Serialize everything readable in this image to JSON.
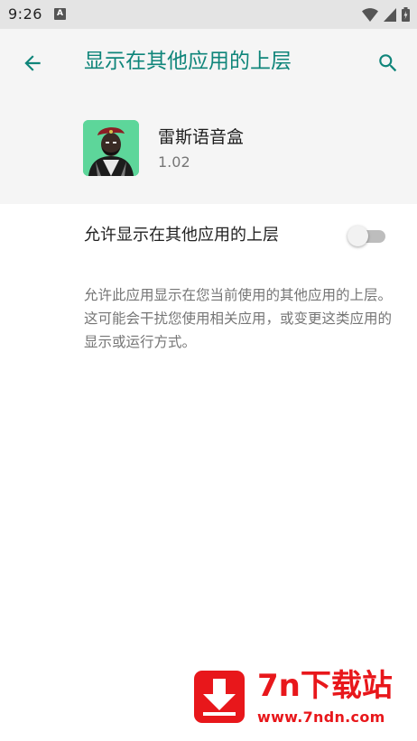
{
  "status_bar": {
    "time": "9:26",
    "notification_icon": "A"
  },
  "header": {
    "back_icon": "arrow-left-icon",
    "title": "显示在其他应用的上层",
    "search_icon": "search-icon",
    "accent_color": "#0f857a"
  },
  "app": {
    "name": "雷斯语音盒",
    "version": "1.02",
    "icon_background": "#5dd69a"
  },
  "setting": {
    "toggle_label": "允许显示在其他应用的上层",
    "toggle_on": false,
    "description": "允许此应用显示在您当前使用的其他应用的上层。这可能会干扰您使用相关应用，或变更这类应用的显示或运行方式。"
  },
  "watermark": {
    "brand": "7n下载站",
    "url": "www.7ndn.com",
    "color": "#e8171b"
  }
}
